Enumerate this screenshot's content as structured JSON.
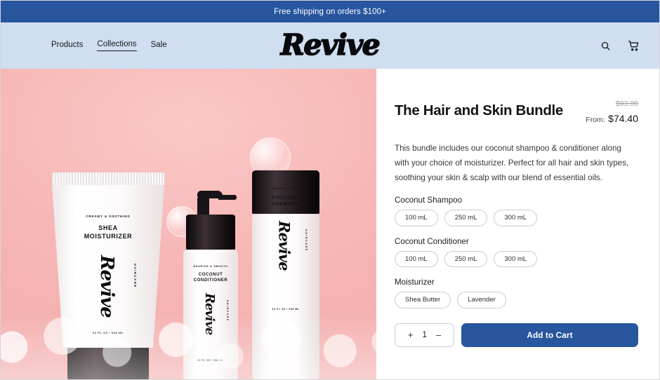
{
  "announcement": {
    "text": "Free shipping on orders $100+"
  },
  "header": {
    "logo": "Revive",
    "nav": [
      {
        "label": "Products",
        "active": false
      },
      {
        "label": "Collections",
        "active": true
      },
      {
        "label": "Sale",
        "active": false
      }
    ],
    "icons": {
      "search": "search-icon",
      "cart": "shopping-cart-icon"
    }
  },
  "gallery": {
    "alt": "Three Revive haircare products on a pink background with soap bubbles",
    "products": [
      {
        "kicker": "CREAMY & SOOTHING",
        "name": "SHEA\nMOISTURIZER",
        "brand": "Revive",
        "brand_sub": "HAIRCARE",
        "volume": "32 FL OZ / 946 ML"
      },
      {
        "kicker": "NOURISH & SMOOTH",
        "name": "COCONUT\nCONDITIONER",
        "brand": "Revive",
        "brand_sub": "HAIRCARE",
        "volume": "32 FL OZ / 946 ML"
      },
      {
        "kicker": "WASH & CLEAN",
        "name": "COCONUT\nSHAMPOO",
        "brand": "Revive",
        "brand_sub": "HAIRCARE",
        "volume": "32 FL OZ / 946 ML"
      }
    ]
  },
  "product": {
    "title": "The Hair and Skin Bundle",
    "price_compare": "$93.00",
    "price_from_label": "From:",
    "price_current": "$74.40",
    "description": "This bundle includes our coconut shampoo & conditioner along with your choice of moisturizer. Perfect for all hair and skin types, soothing your skin & scalp with our blend of essential oils.",
    "options": [
      {
        "label": "Coconut Shampoo",
        "values": [
          "100 mL",
          "250 mL",
          "300 mL"
        ]
      },
      {
        "label": "Coconut Conditioner",
        "values": [
          "100 mL",
          "250 mL",
          "300 mL"
        ]
      },
      {
        "label": "Moisturizer",
        "values": [
          "Shea Butter",
          "Lavender"
        ]
      }
    ],
    "quantity": {
      "increase": "+",
      "value": "1",
      "decrease": "–"
    },
    "add_to_cart": "Add to Cart"
  },
  "colors": {
    "brand_blue": "#27559e",
    "header_blue": "#cfdef0",
    "photo_pink": "#f6b7b6",
    "text_dark": "#111317",
    "muted": "#9aa0a6"
  }
}
